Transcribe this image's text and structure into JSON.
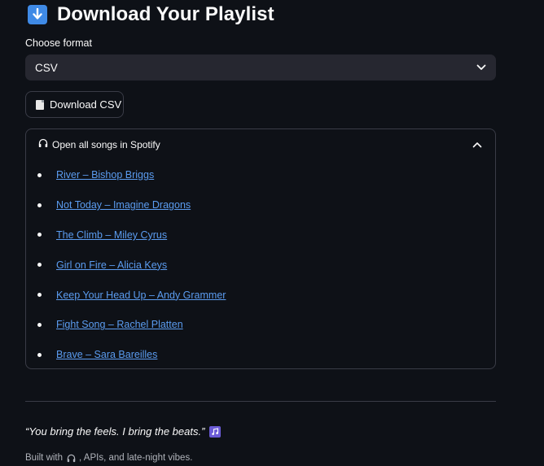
{
  "header": {
    "icon": "down-arrow-icon",
    "title": "Download Your Playlist"
  },
  "format": {
    "label": "Choose format",
    "selected": "CSV"
  },
  "download_button": {
    "icon": "page-icon",
    "label": "Download CSV"
  },
  "expander": {
    "icon": "headphones-icon",
    "title": "Open all songs in Spotify",
    "expanded": true
  },
  "songs": [
    "River – Bishop Briggs",
    "Not Today – Imagine Dragons",
    "The Climb – Miley Cyrus",
    "Girl on Fire – Alicia Keys",
    "Keep Your Head Up – Andy Grammer",
    "Fight Song – Rachel Platten",
    "Brave – Sara Bareilles"
  ],
  "quote": {
    "text": "“You bring the feels. I bring the beats.”",
    "icon": "music-note-icon"
  },
  "footer": {
    "prefix": "Built with",
    "icon": "headphones-icon",
    "suffix": ", APIs, and late-night vibes."
  },
  "colors": {
    "background": "#0e1117",
    "panel": "#262730",
    "border": "#3a3c47",
    "link": "#5b9cf0",
    "text": "#fafafa"
  }
}
